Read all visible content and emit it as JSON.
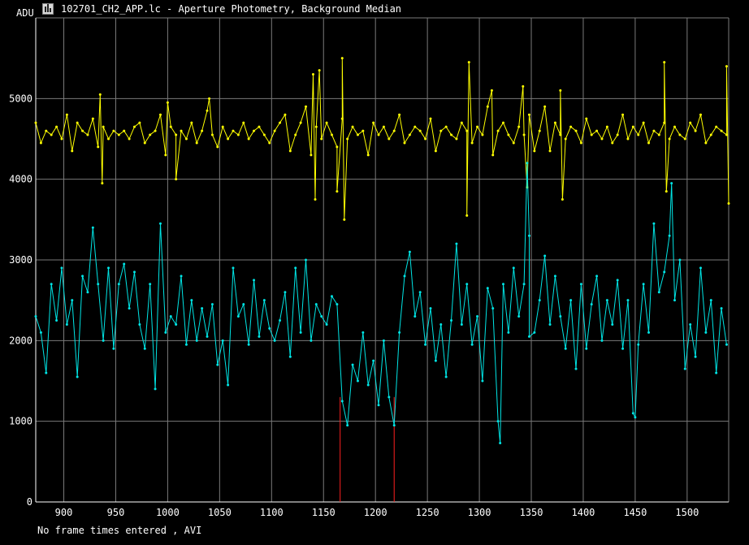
{
  "window": {
    "title": "102701_CH2_APP.lc - Aperture Photometry, Background Median"
  },
  "status_text": "No frame times entered , AVI",
  "colors": {
    "background": "#000000",
    "grid": "#7a7a7a",
    "axis": "#ffffff",
    "series_target": "#ffff00",
    "series_background": "#00e5e5",
    "marker": "#ff2020"
  },
  "chart_data": {
    "type": "line",
    "title": "102701_CH2_APP.lc - Aperture Photometry, Background Median",
    "xlabel": "",
    "ylabel": "ADU",
    "xlim": [
      873,
      1540
    ],
    "ylim": [
      0,
      6000
    ],
    "x_ticks": [
      900,
      950,
      1000,
      1050,
      1100,
      1150,
      1200,
      1250,
      1300,
      1350,
      1400,
      1450,
      1500
    ],
    "y_ticks": [
      0,
      1000,
      2000,
      3000,
      4000,
      5000
    ],
    "grid": true,
    "markers": [
      1166,
      1218
    ],
    "series": [
      {
        "color": "#ffff00",
        "x": [
          873,
          878,
          883,
          888,
          893,
          898,
          903,
          908,
          913,
          918,
          923,
          928,
          933,
          938,
          943,
          948,
          953,
          958,
          963,
          968,
          973,
          978,
          983,
          988,
          993,
          998,
          1003,
          1008,
          1013,
          1018,
          1023,
          1028,
          1033,
          1038,
          1043,
          1048,
          1053,
          1058,
          1063,
          1068,
          1073,
          1078,
          1083,
          1088,
          1093,
          1098,
          1103,
          1108,
          1113,
          1118,
          1123,
          1128,
          1133,
          1138,
          1143,
          1148,
          1153,
          1158,
          1163,
          1168,
          1173,
          1178,
          1183,
          1188,
          1193,
          1198,
          1203,
          1208,
          1213,
          1218,
          1223,
          1228,
          1233,
          1238,
          1243,
          1248,
          1253,
          1258,
          1263,
          1268,
          1273,
          1278,
          1283,
          1288,
          1293,
          1298,
          1303,
          1308,
          1313,
          1318,
          1323,
          1328,
          1333,
          1338,
          1343,
          1348,
          1353,
          1358,
          1363,
          1368,
          1373,
          1378,
          1383,
          1388,
          1393,
          1398,
          1403,
          1408,
          1413,
          1418,
          1423,
          1428,
          1433,
          1438,
          1443,
          1448,
          1453,
          1458,
          1463,
          1468,
          1473,
          1478,
          1483,
          1488,
          1493,
          1498,
          1503,
          1508,
          1513,
          1518,
          1523,
          1528,
          1533,
          1538
        ],
        "y": [
          4700,
          4450,
          4600,
          4550,
          4650,
          4500,
          4800,
          4350,
          4700,
          4600,
          4550,
          4750,
          4400,
          4650,
          4500,
          4600,
          4550,
          4600,
          4500,
          4650,
          4700,
          4450,
          4550,
          4600,
          4800,
          4300,
          4650,
          4550,
          4600,
          4500,
          4700,
          4450,
          4600,
          4850,
          4550,
          4400,
          4650,
          4500,
          4600,
          4550,
          4700,
          4500,
          4600,
          4650,
          4550,
          4450,
          4600,
          4700,
          4800,
          4350,
          4550,
          4700,
          4900,
          4300,
          4650,
          4500,
          4700,
          4550,
          4400,
          4750,
          4500,
          4650,
          4550,
          4600,
          4300,
          4700,
          4550,
          4650,
          4500,
          4600,
          4800,
          4450,
          4550,
          4650,
          4600,
          4500,
          4750,
          4350,
          4600,
          4650,
          4550,
          4500,
          4700,
          4600,
          4450,
          4650,
          4550,
          4900,
          4300,
          4600,
          4700,
          4550,
          4450,
          4650,
          4550,
          4800,
          4350,
          4600,
          4900,
          4350,
          4700,
          4550,
          4500,
          4650,
          4600,
          4450,
          4750,
          4550,
          4600,
          4500,
          4650,
          4450,
          4550,
          4800,
          4500,
          4650,
          4550,
          4700,
          4450,
          4600,
          4550,
          4700,
          4500,
          4650,
          4550,
          4500,
          4700,
          4600,
          4800,
          4450,
          4550,
          4650,
          4600,
          4550
        ],
        "spikes": [
          [
            935,
            5050
          ],
          [
            937,
            3950
          ],
          [
            1000,
            4950
          ],
          [
            1008,
            4000
          ],
          [
            1040,
            5000
          ],
          [
            1140,
            5300
          ],
          [
            1142,
            3750
          ],
          [
            1146,
            5350
          ],
          [
            1163,
            3850
          ],
          [
            1168,
            5500
          ],
          [
            1170,
            3500
          ],
          [
            1290,
            5450
          ],
          [
            1288,
            3550
          ],
          [
            1312,
            5100
          ],
          [
            1342,
            5150
          ],
          [
            1346,
            3900
          ],
          [
            1378,
            5100
          ],
          [
            1380,
            3750
          ],
          [
            1478,
            5450
          ],
          [
            1480,
            3850
          ],
          [
            1538,
            5400
          ],
          [
            1540,
            3700
          ]
        ]
      },
      {
        "color": "#00e5e5",
        "x": [
          873,
          878,
          883,
          888,
          893,
          898,
          903,
          908,
          913,
          918,
          923,
          928,
          933,
          938,
          943,
          948,
          953,
          958,
          963,
          968,
          973,
          978,
          983,
          988,
          993,
          998,
          1003,
          1008,
          1013,
          1018,
          1023,
          1028,
          1033,
          1038,
          1043,
          1048,
          1053,
          1058,
          1063,
          1068,
          1073,
          1078,
          1083,
          1088,
          1093,
          1098,
          1103,
          1108,
          1113,
          1118,
          1123,
          1128,
          1133,
          1138,
          1143,
          1148,
          1153,
          1158,
          1163,
          1168,
          1173,
          1178,
          1183,
          1188,
          1193,
          1198,
          1203,
          1208,
          1213,
          1218,
          1223,
          1228,
          1233,
          1238,
          1243,
          1248,
          1253,
          1258,
          1263,
          1268,
          1273,
          1278,
          1283,
          1288,
          1293,
          1298,
          1303,
          1308,
          1313,
          1318,
          1323,
          1328,
          1333,
          1338,
          1343,
          1348,
          1353,
          1358,
          1363,
          1368,
          1373,
          1378,
          1383,
          1388,
          1393,
          1398,
          1403,
          1408,
          1413,
          1418,
          1423,
          1428,
          1433,
          1438,
          1443,
          1448,
          1453,
          1458,
          1463,
          1468,
          1473,
          1478,
          1483,
          1488,
          1493,
          1498,
          1503,
          1508,
          1513,
          1518,
          1523,
          1528,
          1533,
          1538
        ],
        "y": [
          2300,
          2100,
          1600,
          2700,
          2250,
          2900,
          2200,
          2500,
          1550,
          2800,
          2600,
          3400,
          2700,
          2000,
          2900,
          1900,
          2700,
          2950,
          2400,
          2850,
          2200,
          1900,
          2700,
          1400,
          3450,
          2100,
          2300,
          2200,
          2800,
          1950,
          2500,
          2000,
          2400,
          2050,
          2450,
          1700,
          2000,
          1450,
          2900,
          2300,
          2450,
          1950,
          2750,
          2050,
          2500,
          2150,
          2000,
          2250,
          2600,
          1800,
          2900,
          2100,
          3000,
          2000,
          2450,
          2300,
          2200,
          2550,
          2450,
          1250,
          950,
          1700,
          1500,
          2100,
          1450,
          1750,
          1200,
          2000,
          1300,
          950,
          2100,
          2800,
          3100,
          2300,
          2600,
          1950,
          2400,
          1750,
          2200,
          1550,
          2250,
          3200,
          2200,
          2700,
          1950,
          2300,
          1500,
          2650,
          2400,
          1000,
          2700,
          2100,
          2900,
          2300,
          2700,
          3300,
          2100,
          2500,
          3050,
          2200,
          2800,
          2300,
          1900,
          2500,
          1650,
          2700,
          1900,
          2450,
          2800,
          2000,
          2500,
          2200,
          2750,
          1900,
          2500,
          1100,
          1950,
          2700,
          2100,
          3450,
          2600,
          2850,
          3300,
          2500,
          3000,
          1650,
          2200,
          1800,
          2900,
          2100,
          2500,
          1600,
          2400,
          1950
        ],
        "spikes": [
          [
            1320,
            730
          ],
          [
            1346,
            4200
          ],
          [
            1348,
            2050
          ],
          [
            1450,
            1050
          ],
          [
            1485,
            3950
          ]
        ]
      }
    ]
  }
}
